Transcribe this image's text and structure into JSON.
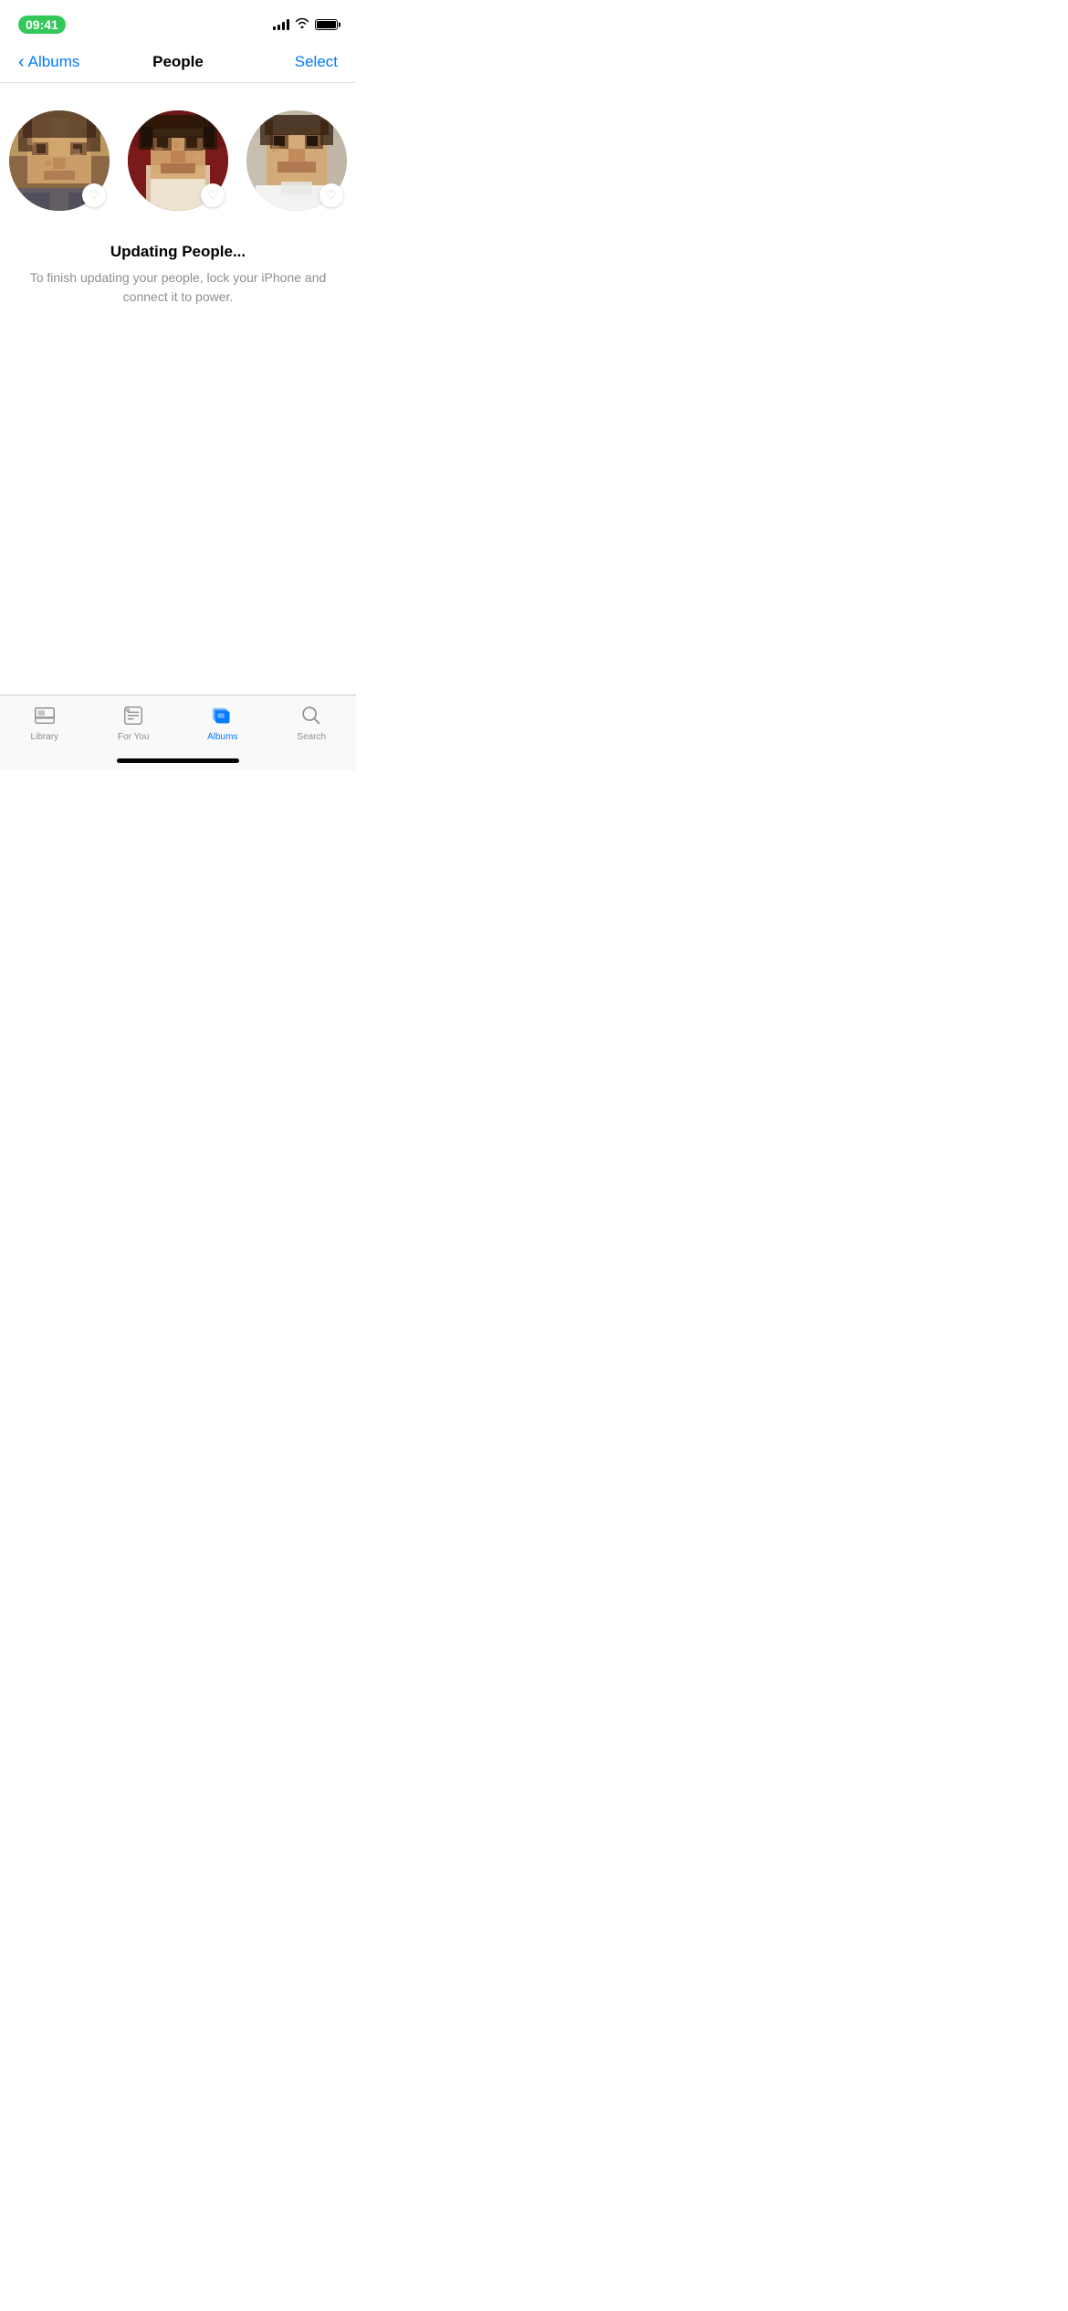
{
  "statusBar": {
    "time": "09:41",
    "signalBars": 4,
    "wifiOn": true,
    "batteryFull": true
  },
  "navBar": {
    "backLabel": "Albums",
    "title": "People",
    "selectLabel": "Select"
  },
  "peopleSection": {
    "people": [
      {
        "id": "person-1",
        "heartFavorited": false
      },
      {
        "id": "person-2",
        "heartFavorited": false
      },
      {
        "id": "person-3",
        "heartFavorited": false
      }
    ]
  },
  "statusMessage": {
    "title": "Updating People...",
    "body": "To finish updating your people, lock your iPhone and connect it to power."
  },
  "tabBar": {
    "tabs": [
      {
        "id": "library",
        "label": "Library",
        "active": false
      },
      {
        "id": "for-you",
        "label": "For You",
        "active": false
      },
      {
        "id": "albums",
        "label": "Albums",
        "active": true
      },
      {
        "id": "search",
        "label": "Search",
        "active": false
      }
    ]
  }
}
